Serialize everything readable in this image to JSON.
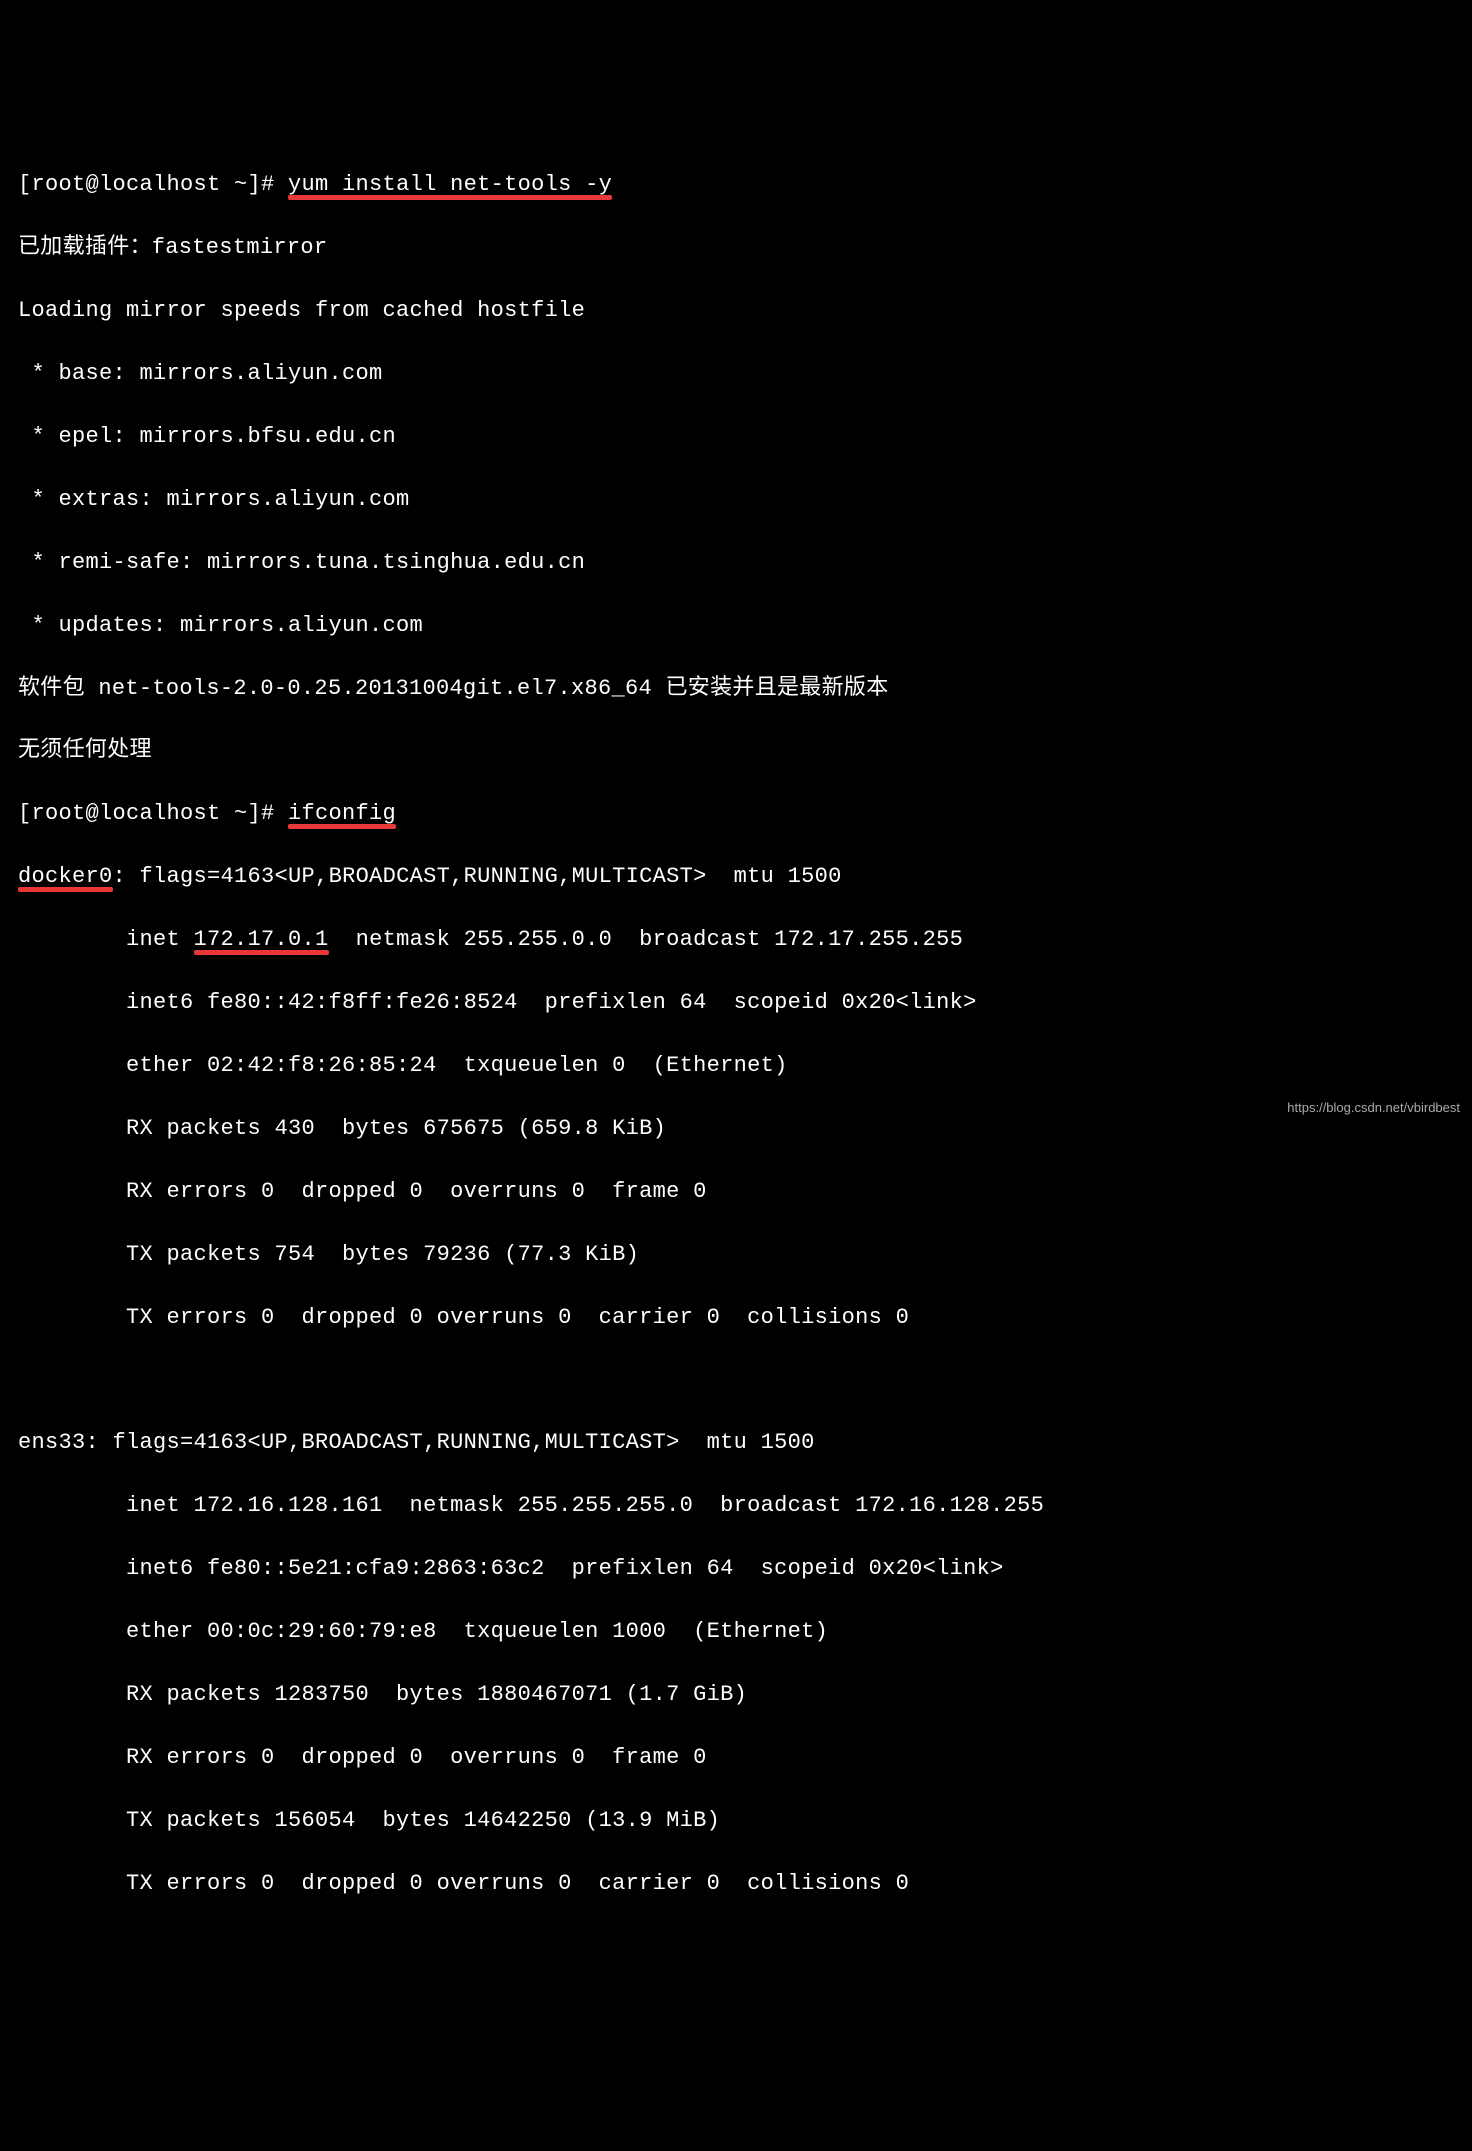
{
  "prompt1": {
    "prefix": "[root@localhost ~]# ",
    "cmd": "yum install net-tools -y"
  },
  "yum_output": {
    "l1": "已加载插件：fastestmirror",
    "l2": "Loading mirror speeds from cached hostfile",
    "l3": " * base: mirrors.aliyun.com",
    "l4": " * epel: mirrors.bfsu.edu.cn",
    "l5": " * extras: mirrors.aliyun.com",
    "l6": " * remi-safe: mirrors.tuna.tsinghua.edu.cn",
    "l7": " * updates: mirrors.aliyun.com",
    "l8": "软件包 net-tools-2.0-0.25.20131004git.el7.x86_64 已安装并且是最新版本",
    "l9": "无须任何处理"
  },
  "prompt2": {
    "prefix": "[root@localhost ~]# ",
    "cmd": "ifconfig"
  },
  "docker0": {
    "name": "docker0",
    "colon": ":",
    "flags": " flags=4163<UP,BROADCAST,RUNNING,MULTICAST>  mtu 1500",
    "inet_pre": "        inet ",
    "inet_ip": "172.17.0.1",
    "inet_post": "  netmask 255.255.0.0  broadcast 172.17.255.255",
    "inet6": "        inet6 fe80::42:f8ff:fe26:8524  prefixlen 64  scopeid 0x20<link>",
    "ether": "        ether 02:42:f8:26:85:24  txqueuelen 0  (Ethernet)",
    "rx1": "        RX packets 430  bytes 675675 (659.8 KiB)",
    "rx2": "        RX errors 0  dropped 0  overruns 0  frame 0",
    "tx1": "        TX packets 754  bytes 79236 (77.3 KiB)",
    "tx2": "        TX errors 0  dropped 0 overruns 0  carrier 0  collisions 0"
  },
  "ens33": {
    "header": "ens33: flags=4163<UP,BROADCAST,RUNNING,MULTICAST>  mtu 1500",
    "inet": "        inet 172.16.128.161  netmask 255.255.255.0  broadcast 172.16.128.255",
    "inet6": "        inet6 fe80::5e21:cfa9:2863:63c2  prefixlen 64  scopeid 0x20<link>",
    "ether": "        ether 00:0c:29:60:79:e8  txqueuelen 1000  (Ethernet)",
    "rx1": "        RX packets 1283750  bytes 1880467071 (1.7 GiB)",
    "rx2": "        RX errors 0  dropped 0  overruns 0  frame 0",
    "tx1": "        TX packets 156054  bytes 14642250 (13.9 MiB)",
    "tx2": "        TX errors 0  dropped 0 overruns 0  carrier 0  collisions 0"
  },
  "watermark": "https://blog.csdn.net/vbirdbest"
}
